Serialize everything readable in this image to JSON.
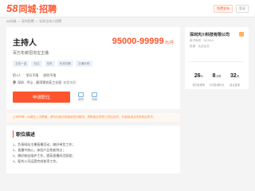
{
  "header": {
    "logo_num": "58",
    "logo_text": "同城·招聘",
    "btn_post": "免费发布",
    "btn_user": "登录"
  },
  "breadcrumb": [
    "58同城",
    ">",
    "深圳招聘",
    ">",
    "深圳主持人招聘"
  ],
  "job": {
    "title": "主持人",
    "salary": "95000-99999",
    "salary_unit": "元/月",
    "subtitle": "百万年薪招淘宝主播",
    "tags": [
      "五险一金",
      "包住",
      "包吃",
      "年底双薪",
      "交通补助"
    ],
    "requirements": [
      "招1人",
      "学历不限",
      "经验不限"
    ],
    "address": "深圳 - 坪山 - 碧湾锦池苑工业园",
    "address_extra": "查看地图",
    "apply_label": "申请职位",
    "action1": "微聊",
    "action2": "收藏"
  },
  "tip": "公司声明：为避免上当受骗，请勿在面试前缴纳任何费用。求职者必须签订劳动合同，仔细阅读合同条款后签字。",
  "description": {
    "title": "职位描述",
    "items": [
      "1、负责网站主播直播活动，做好带货工作；",
      "2、直播中热心，体验产品性能特点；",
      "3、做好粉丝维护工作，提高直播间活跃度；",
      "4、配合公司运营完成各项工作。"
    ]
  },
  "company": {
    "name": "深圳天川科技有限公司",
    "meta": "电子商务 · 50-99人",
    "meta2": "民营 · 认证企业",
    "stats": [
      {
        "num": "26",
        "unit": "%",
        "label": "简历处理率"
      },
      {
        "num": "8",
        "unit": "小时",
        "label": "平均处理时长"
      },
      {
        "num": "32",
        "unit": "天",
        "label": "最近登录"
      }
    ]
  },
  "colors": {
    "brand": "#ff552e",
    "accent_blue": "#7bb0e3"
  }
}
